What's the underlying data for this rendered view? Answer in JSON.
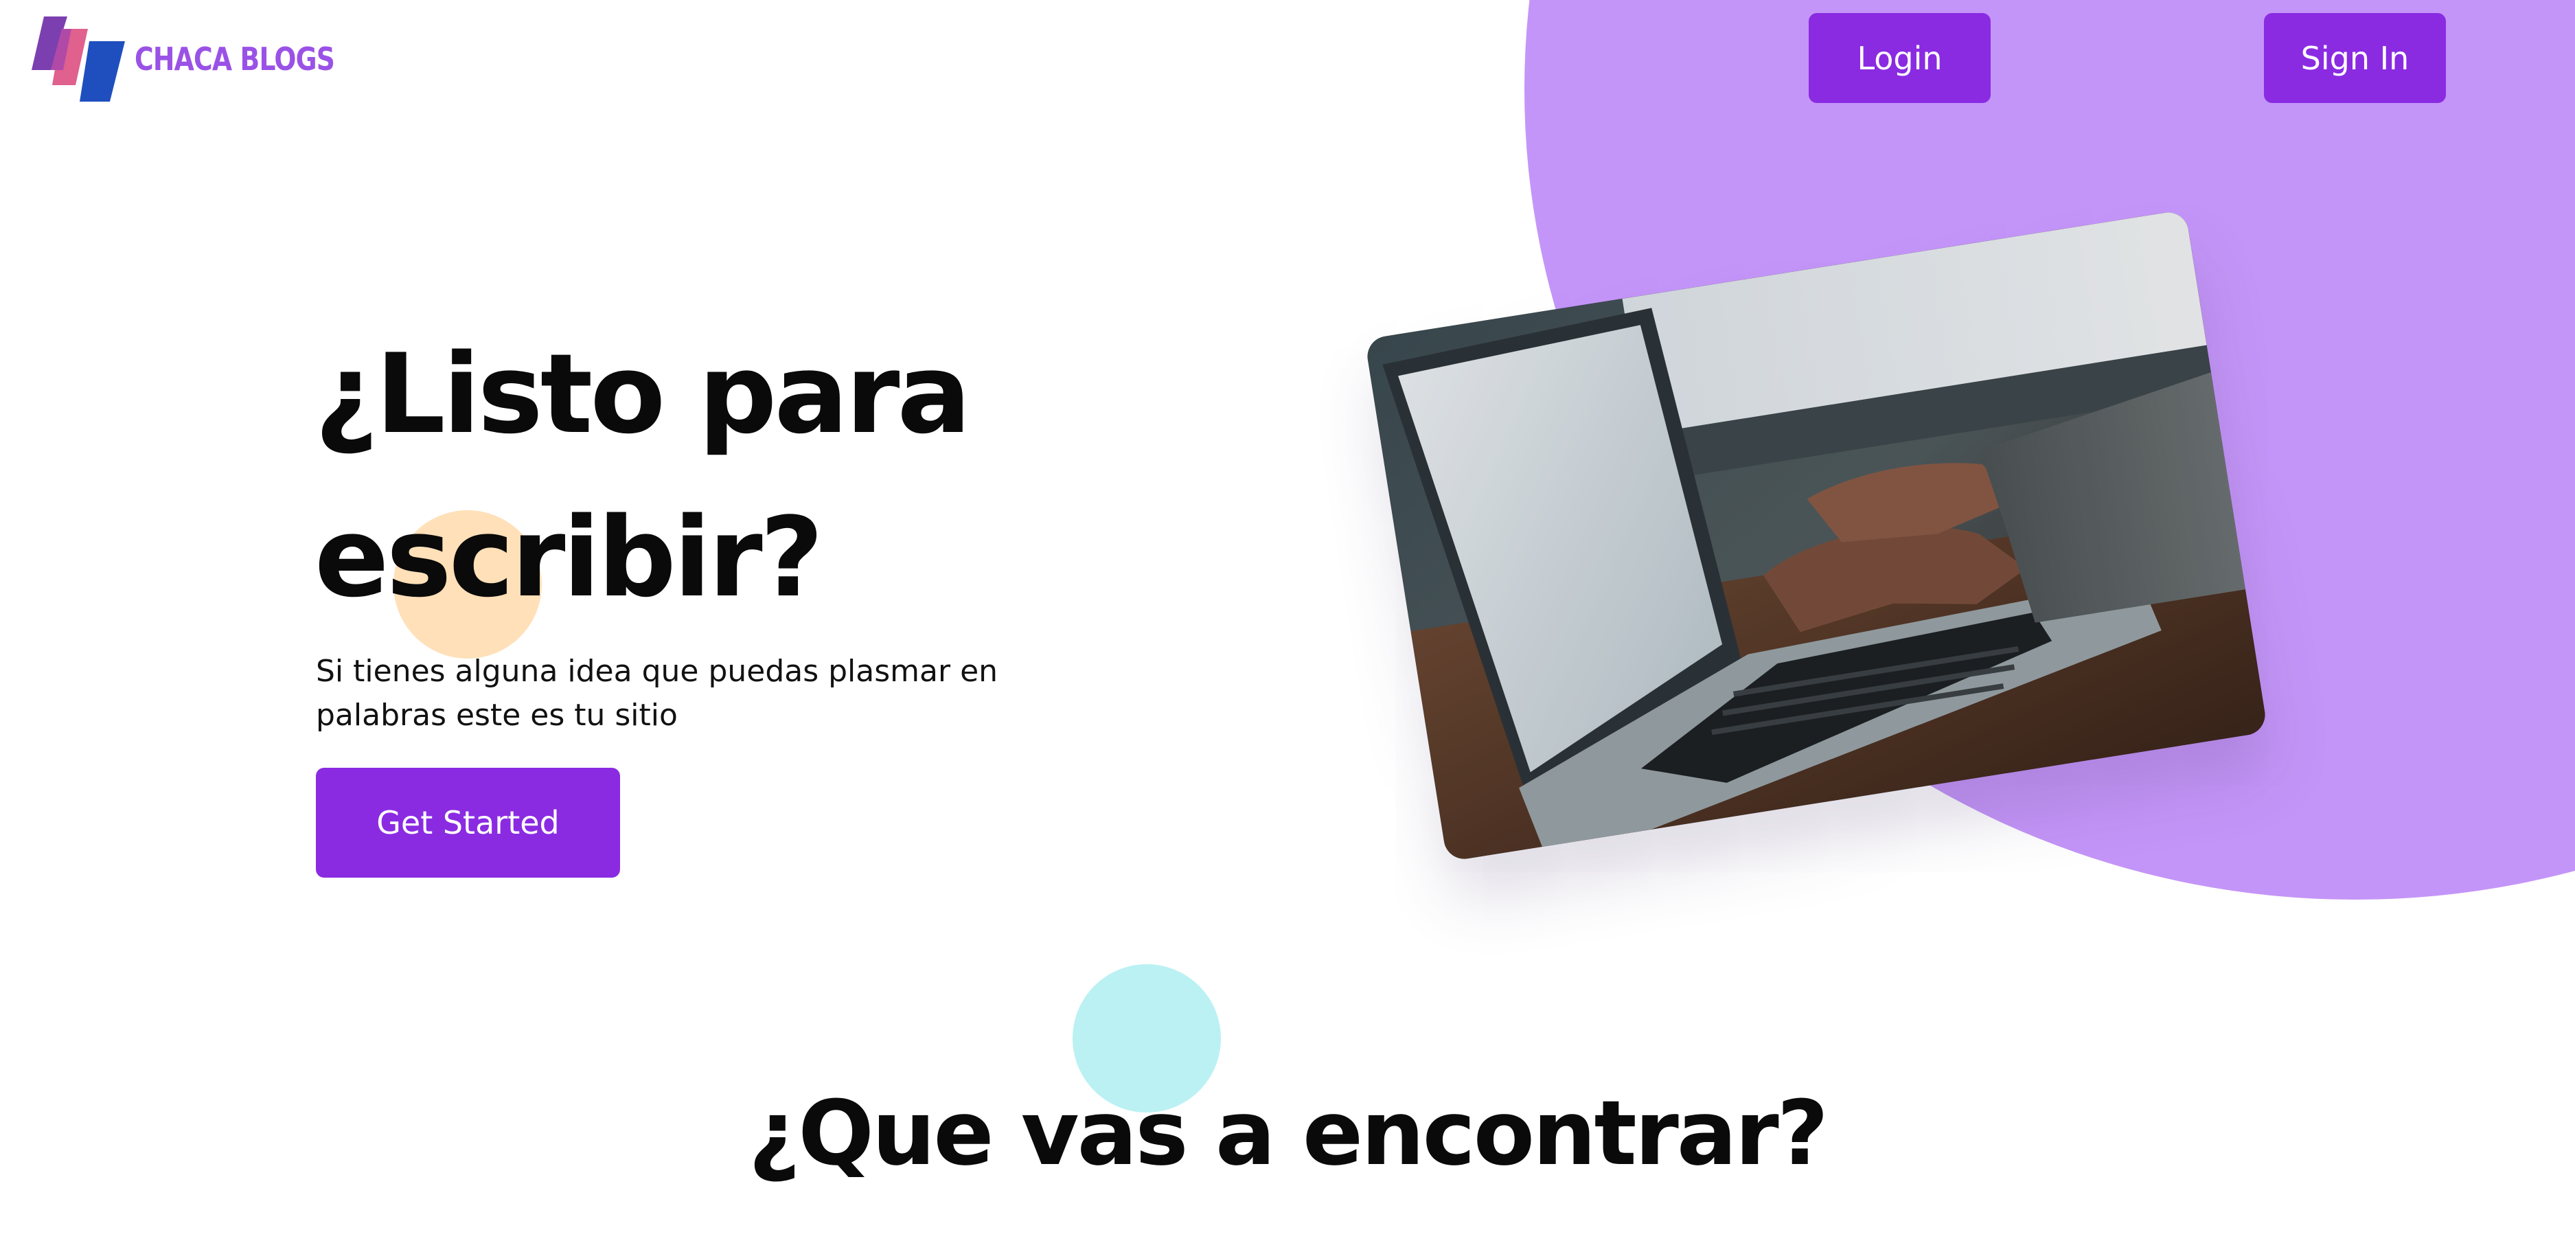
{
  "brand": {
    "name": "CHACA BLOGS",
    "color": "#9a52e6"
  },
  "header": {
    "login_label": "Login",
    "signin_label": "Sign In"
  },
  "hero": {
    "title": "¿Listo para escribir?",
    "subtitle": "Si tienes alguna idea que puedas plasmar en palabras este es tu sitio",
    "cta_label": "Get Started",
    "image_subject": "hands-typing-on-laptop"
  },
  "section": {
    "title": "¿Que vas a encontrar?"
  },
  "colors": {
    "accent": "#8a2be2",
    "blob": "#c495f8",
    "peach_dot": "#ffe0b8",
    "cyan_dot": "#bbf1f3",
    "text": "#0a0a0a"
  }
}
